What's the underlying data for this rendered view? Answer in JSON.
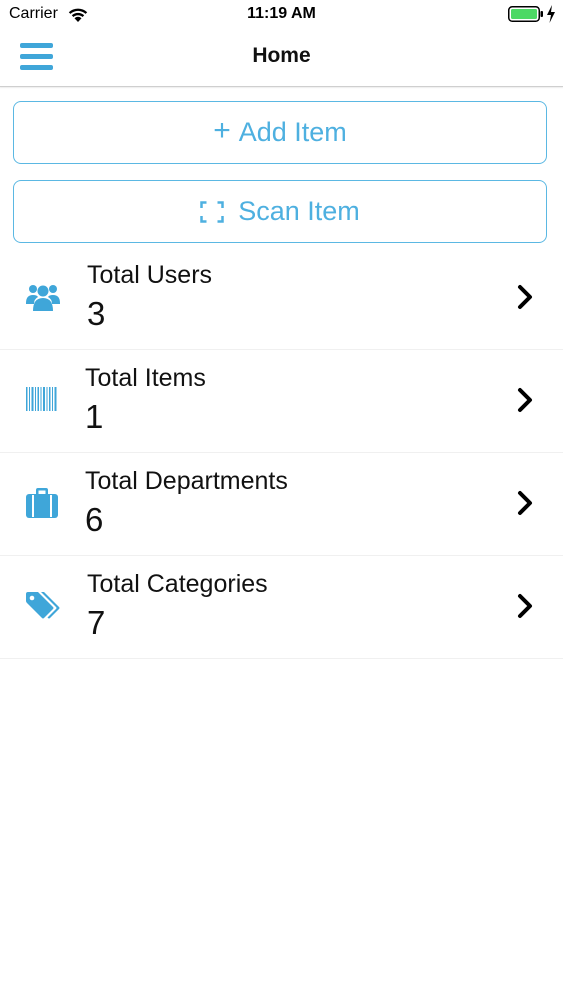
{
  "status_bar": {
    "carrier": "Carrier",
    "time": "11:19 AM"
  },
  "nav": {
    "title": "Home",
    "menu_icon": "hamburger-menu-icon"
  },
  "actions": {
    "add_label": "Add Item",
    "add_icon": "plus",
    "scan_label": "Scan Item",
    "scan_icon": "scan-frame-icon"
  },
  "stats": [
    {
      "label": "Total Users",
      "value": "3",
      "icon": "users-icon"
    },
    {
      "label": "Total Items",
      "value": "1",
      "icon": "barcode-icon"
    },
    {
      "label": "Total Departments",
      "value": "6",
      "icon": "briefcase-icon"
    },
    {
      "label": "Total Categories",
      "value": "7",
      "icon": "tags-icon"
    }
  ],
  "colors": {
    "accent": "#4eb0e0",
    "icon": "#3fa6d9",
    "battery": "#4cd964"
  }
}
